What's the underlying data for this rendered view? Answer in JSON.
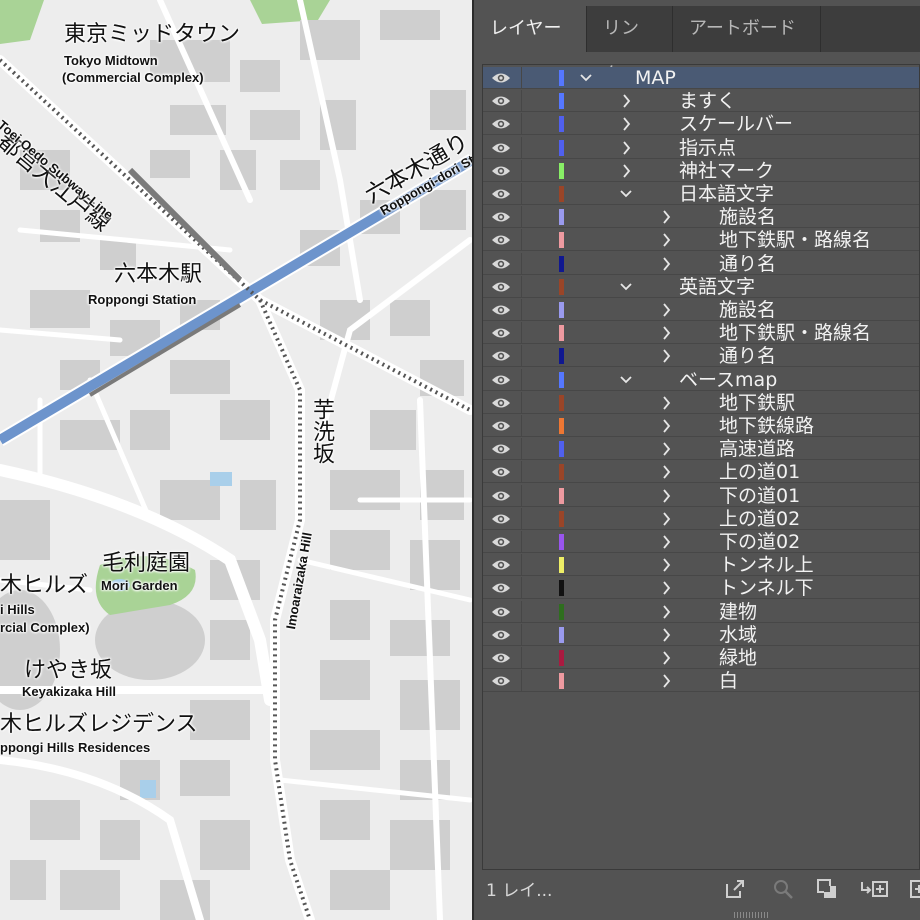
{
  "panel": {
    "tabs": [
      {
        "label": "レイヤー",
        "active": true
      },
      {
        "label": "リンク",
        "active": false
      },
      {
        "label": "アートボード",
        "active": false
      }
    ],
    "layers": [
      {
        "name": "MAP",
        "depth": 0,
        "expanded": true,
        "color": "#5577ff",
        "selected": true
      },
      {
        "name": "ますく",
        "depth": 1,
        "expanded": false,
        "color": "#5577ff"
      },
      {
        "name": "スケールバー",
        "depth": 1,
        "expanded": false,
        "color": "#5060ee"
      },
      {
        "name": "指示点",
        "depth": 1,
        "expanded": false,
        "color": "#5060ee"
      },
      {
        "name": "神社マーク",
        "depth": 1,
        "expanded": false,
        "color": "#88ee66"
      },
      {
        "name": "日本語文字",
        "depth": 1,
        "expanded": true,
        "color": "#9a4528"
      },
      {
        "name": "施設名",
        "depth": 2,
        "expanded": false,
        "color": "#9a9aee"
      },
      {
        "name": "地下鉄駅・路線名",
        "depth": 2,
        "expanded": false,
        "color": "#ee9aa0"
      },
      {
        "name": "通り名",
        "depth": 2,
        "expanded": false,
        "color": "#101890"
      },
      {
        "name": "英語文字",
        "depth": 1,
        "expanded": true,
        "color": "#9a4528"
      },
      {
        "name": "施設名",
        "depth": 2,
        "expanded": false,
        "color": "#9a9aee"
      },
      {
        "name": "地下鉄駅・路線名",
        "depth": 2,
        "expanded": false,
        "color": "#ee9aa0"
      },
      {
        "name": "通り名",
        "depth": 2,
        "expanded": false,
        "color": "#101890"
      },
      {
        "name": "ベースmap",
        "depth": 1,
        "expanded": true,
        "color": "#5577ff"
      },
      {
        "name": "地下鉄駅",
        "depth": 2,
        "expanded": false,
        "color": "#9a4528"
      },
      {
        "name": "地下鉄線路",
        "depth": 2,
        "expanded": false,
        "color": "#ee7733"
      },
      {
        "name": "高速道路",
        "depth": 2,
        "expanded": false,
        "color": "#5060ee"
      },
      {
        "name": "上の道01",
        "depth": 2,
        "expanded": false,
        "color": "#9a4528"
      },
      {
        "name": "下の道01",
        "depth": 2,
        "expanded": false,
        "color": "#ee9aa0"
      },
      {
        "name": "上の道02",
        "depth": 2,
        "expanded": false,
        "color": "#9a4528"
      },
      {
        "name": "下の道02",
        "depth": 2,
        "expanded": false,
        "color": "#9955ee"
      },
      {
        "name": "トンネル上",
        "depth": 2,
        "expanded": false,
        "color": "#eeee66"
      },
      {
        "name": "トンネル下",
        "depth": 2,
        "expanded": false,
        "color": "#111111"
      },
      {
        "name": "建物",
        "depth": 2,
        "expanded": false,
        "color": "#2e6e1e"
      },
      {
        "name": "水域",
        "depth": 2,
        "expanded": false,
        "color": "#9a9aee"
      },
      {
        "name": "緑地",
        "depth": 2,
        "expanded": false,
        "color": "#aa1a40"
      },
      {
        "name": "白",
        "depth": 2,
        "expanded": false,
        "color": "#ee9aa0"
      }
    ],
    "footer": {
      "count": "1 レイ...",
      "icons": [
        "export-icon",
        "locate-object-icon",
        "make-clipping-mask-icon",
        "new-sublayer-icon",
        "new-layer-icon"
      ]
    }
  },
  "map": {
    "labels": {
      "midtown_ja": "東京ミッドタウン",
      "midtown_en1": "Tokyo Midtown",
      "midtown_en2": "(Commercial Complex)",
      "oedo_ja": "都営大江戸線",
      "oedo_en": "Toei Oedo Subway Line",
      "roppongi_dori_ja": "六本木通り",
      "roppongi_dori_en": "Roppongi-dori St.",
      "station_ja": "六本木駅",
      "station_en": "Roppongi Station",
      "imoarai_ja": "芋洗坂",
      "imoarai_en": "Imoaraizaka Hill",
      "mori_garden_ja": "毛利庭園",
      "mori_garden_en": "Mori Garden",
      "hills_ja": "木ヒルズ",
      "hills_en1": "i Hills",
      "hills_en2": "rcial Complex)",
      "keyakizaka_ja": "けやき坂",
      "keyakizaka_en": "Keyakizaka Hill",
      "residences_ja": "木ヒルズレジデンス",
      "residences_en": "ppongi Hills Residences"
    }
  }
}
